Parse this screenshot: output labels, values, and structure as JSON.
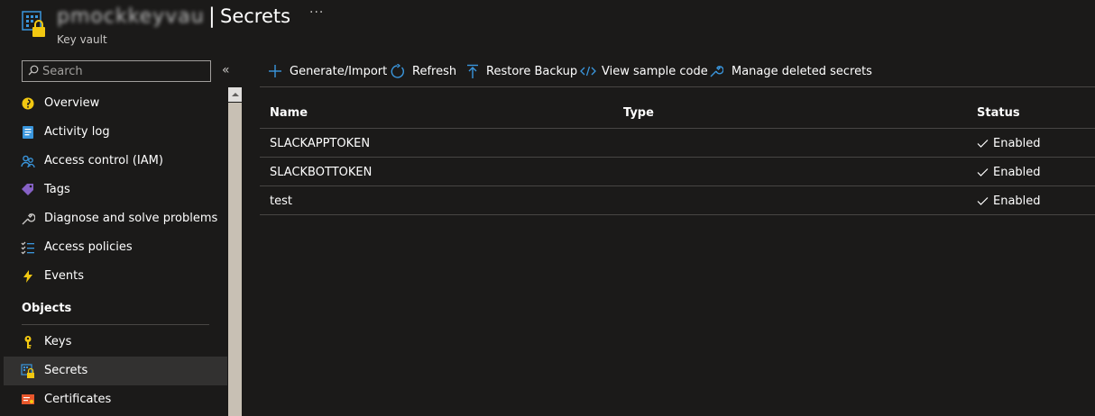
{
  "header": {
    "vault_name": "pmockkeyvault",
    "separator": "|",
    "title": "Secrets",
    "subtitle": "Key vault",
    "more": "···"
  },
  "sidebar": {
    "search_placeholder": "Search",
    "collapse": "«",
    "items": [
      {
        "label": "Overview",
        "icon": "overview-icon"
      },
      {
        "label": "Activity log",
        "icon": "activity-log-icon"
      },
      {
        "label": "Access control (IAM)",
        "icon": "access-control-icon"
      },
      {
        "label": "Tags",
        "icon": "tag-icon"
      },
      {
        "label": "Diagnose and solve problems",
        "icon": "wrench-icon"
      },
      {
        "label": "Access policies",
        "icon": "access-policies-icon"
      },
      {
        "label": "Events",
        "icon": "lightning-icon"
      }
    ],
    "section": "Objects",
    "object_items": [
      {
        "label": "Keys",
        "icon": "key-icon"
      },
      {
        "label": "Secrets",
        "icon": "secrets-icon",
        "selected": true
      },
      {
        "label": "Certificates",
        "icon": "certificate-icon"
      }
    ]
  },
  "toolbar": {
    "generate_import": "Generate/Import",
    "refresh": "Refresh",
    "restore_backup": "Restore Backup",
    "view_sample_code": "View sample code",
    "manage_deleted": "Manage deleted secrets"
  },
  "table": {
    "columns": [
      "Name",
      "Type",
      "Status"
    ],
    "rows": [
      {
        "name": "SLACKAPPTOKEN",
        "type": "",
        "status": "Enabled"
      },
      {
        "name": "SLACKBOTTOKEN",
        "type": "",
        "status": "Enabled"
      },
      {
        "name": "test",
        "type": "",
        "status": "Enabled"
      }
    ]
  },
  "colors": {
    "background": "#1b1a19",
    "accent": "#3a96dd",
    "selected": "#323130"
  }
}
